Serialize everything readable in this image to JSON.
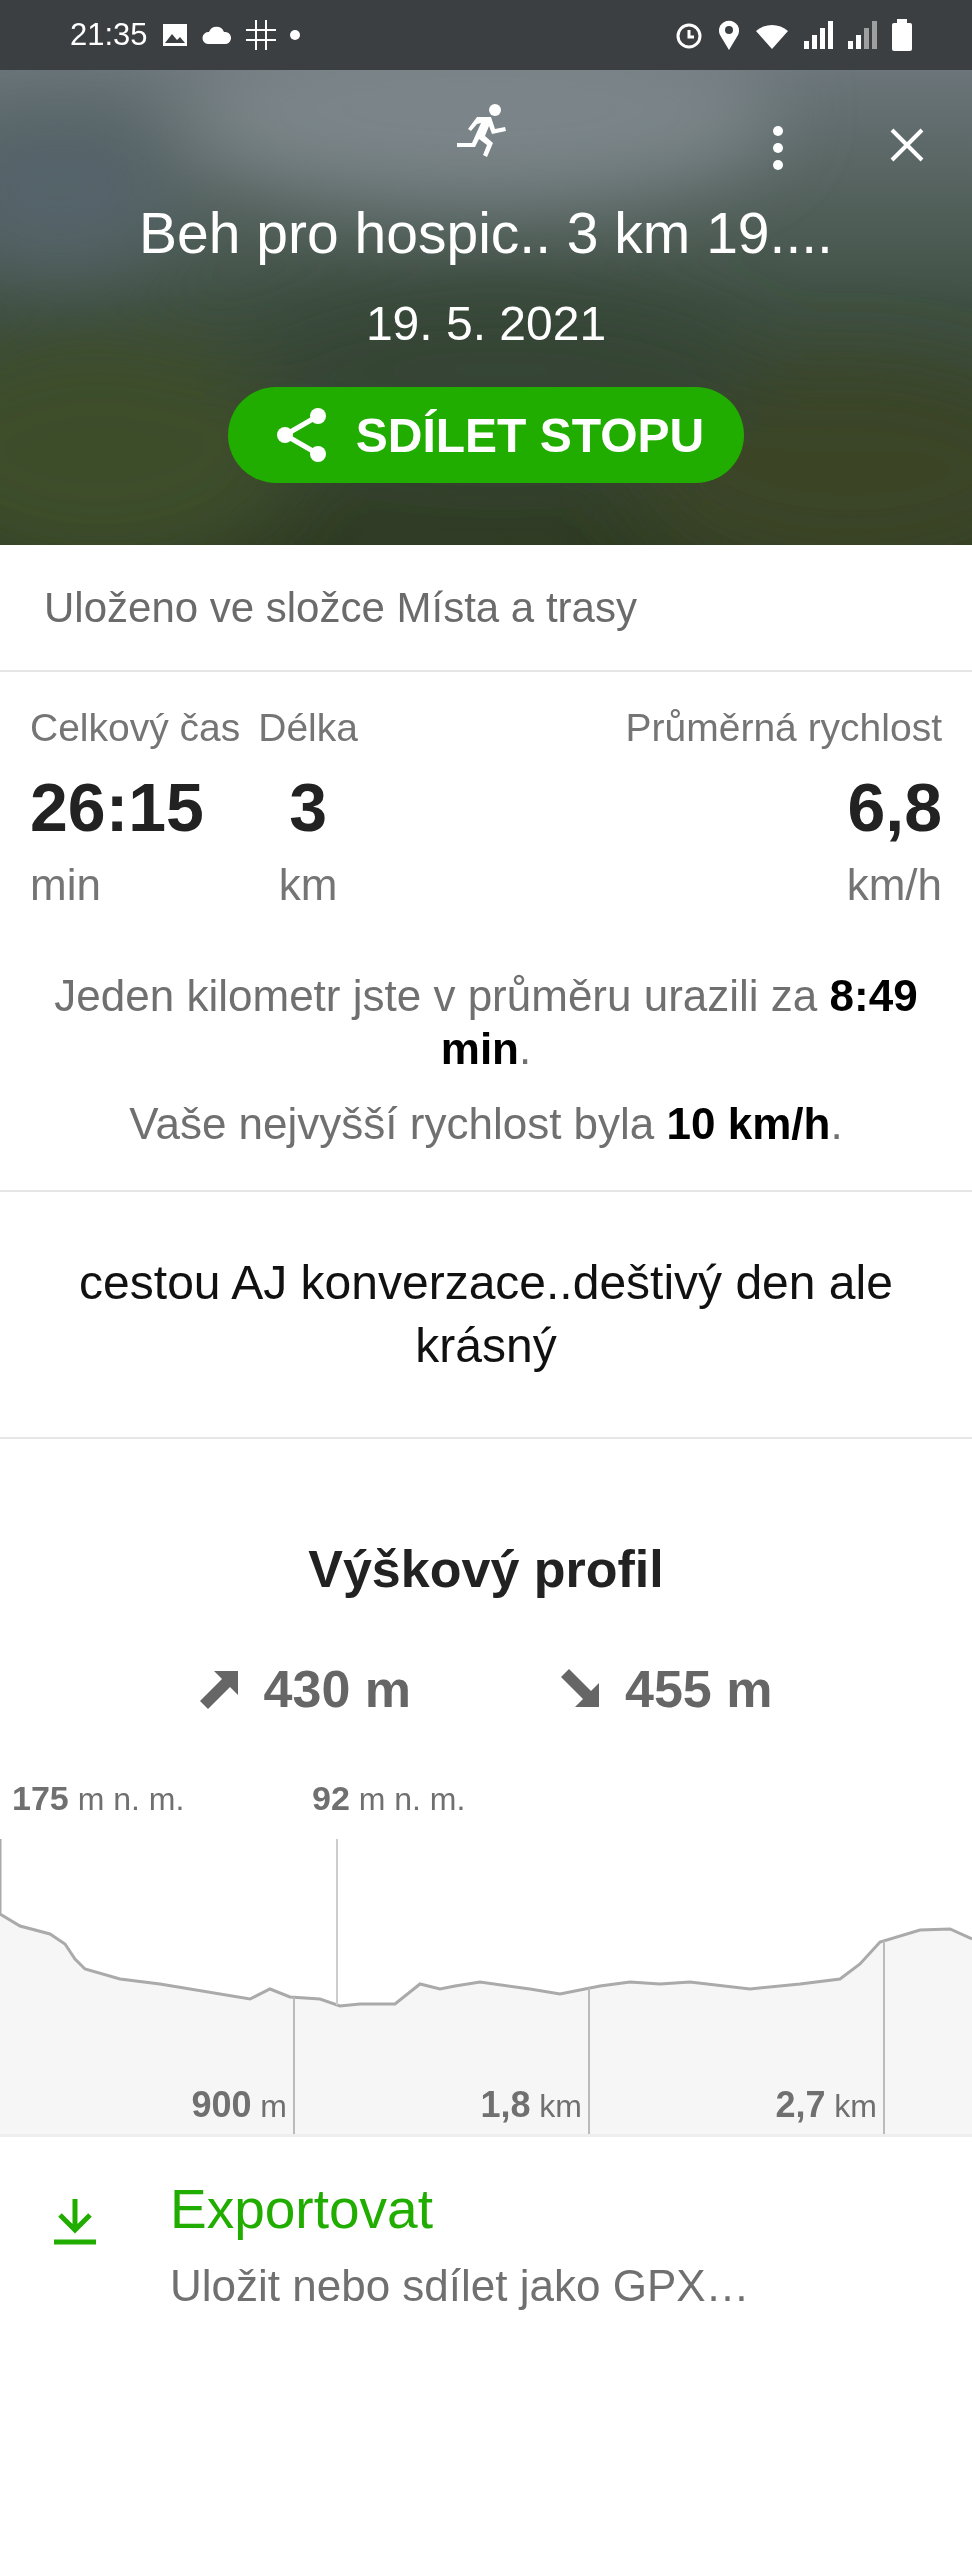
{
  "status_bar": {
    "time": "21:35"
  },
  "header": {
    "title": "Beh pro hospic.. 3 km 19....",
    "date": "19. 5. 2021",
    "share_button": "SDÍLET STOPU"
  },
  "folder_note": "Uloženo ve složce Místa a trasy",
  "stats": [
    {
      "label": "Celkový čas",
      "value": "26:15",
      "unit": "min"
    },
    {
      "label": "Délka",
      "value": "3",
      "unit": "km"
    },
    {
      "label": "Průměrná rychlost",
      "value": "6,8",
      "unit": "km/h"
    }
  ],
  "summary": [
    "Jeden kilometr jste v průměru urazili za **8:49 min**.",
    "Vaše nejvyšší rychlost byla **10 km/h**."
  ],
  "note": "cestou AJ konverzace..deštivý den ale krásný",
  "elevation": {
    "title": "Výškový profil",
    "ascent": "430 m",
    "descent": "455 m",
    "max": {
      "value": "175",
      "unit": "m n. m."
    },
    "min": {
      "value": "92",
      "unit": "m n. m."
    },
    "distance_marks": [
      {
        "value": "900",
        "unit": "m"
      },
      {
        "value": "1,8",
        "unit": "km"
      },
      {
        "value": "2,7",
        "unit": "km"
      }
    ]
  },
  "export": {
    "title": "Exportovat",
    "subtitle": "Uložit nebo sdílet jako GPX…"
  }
}
